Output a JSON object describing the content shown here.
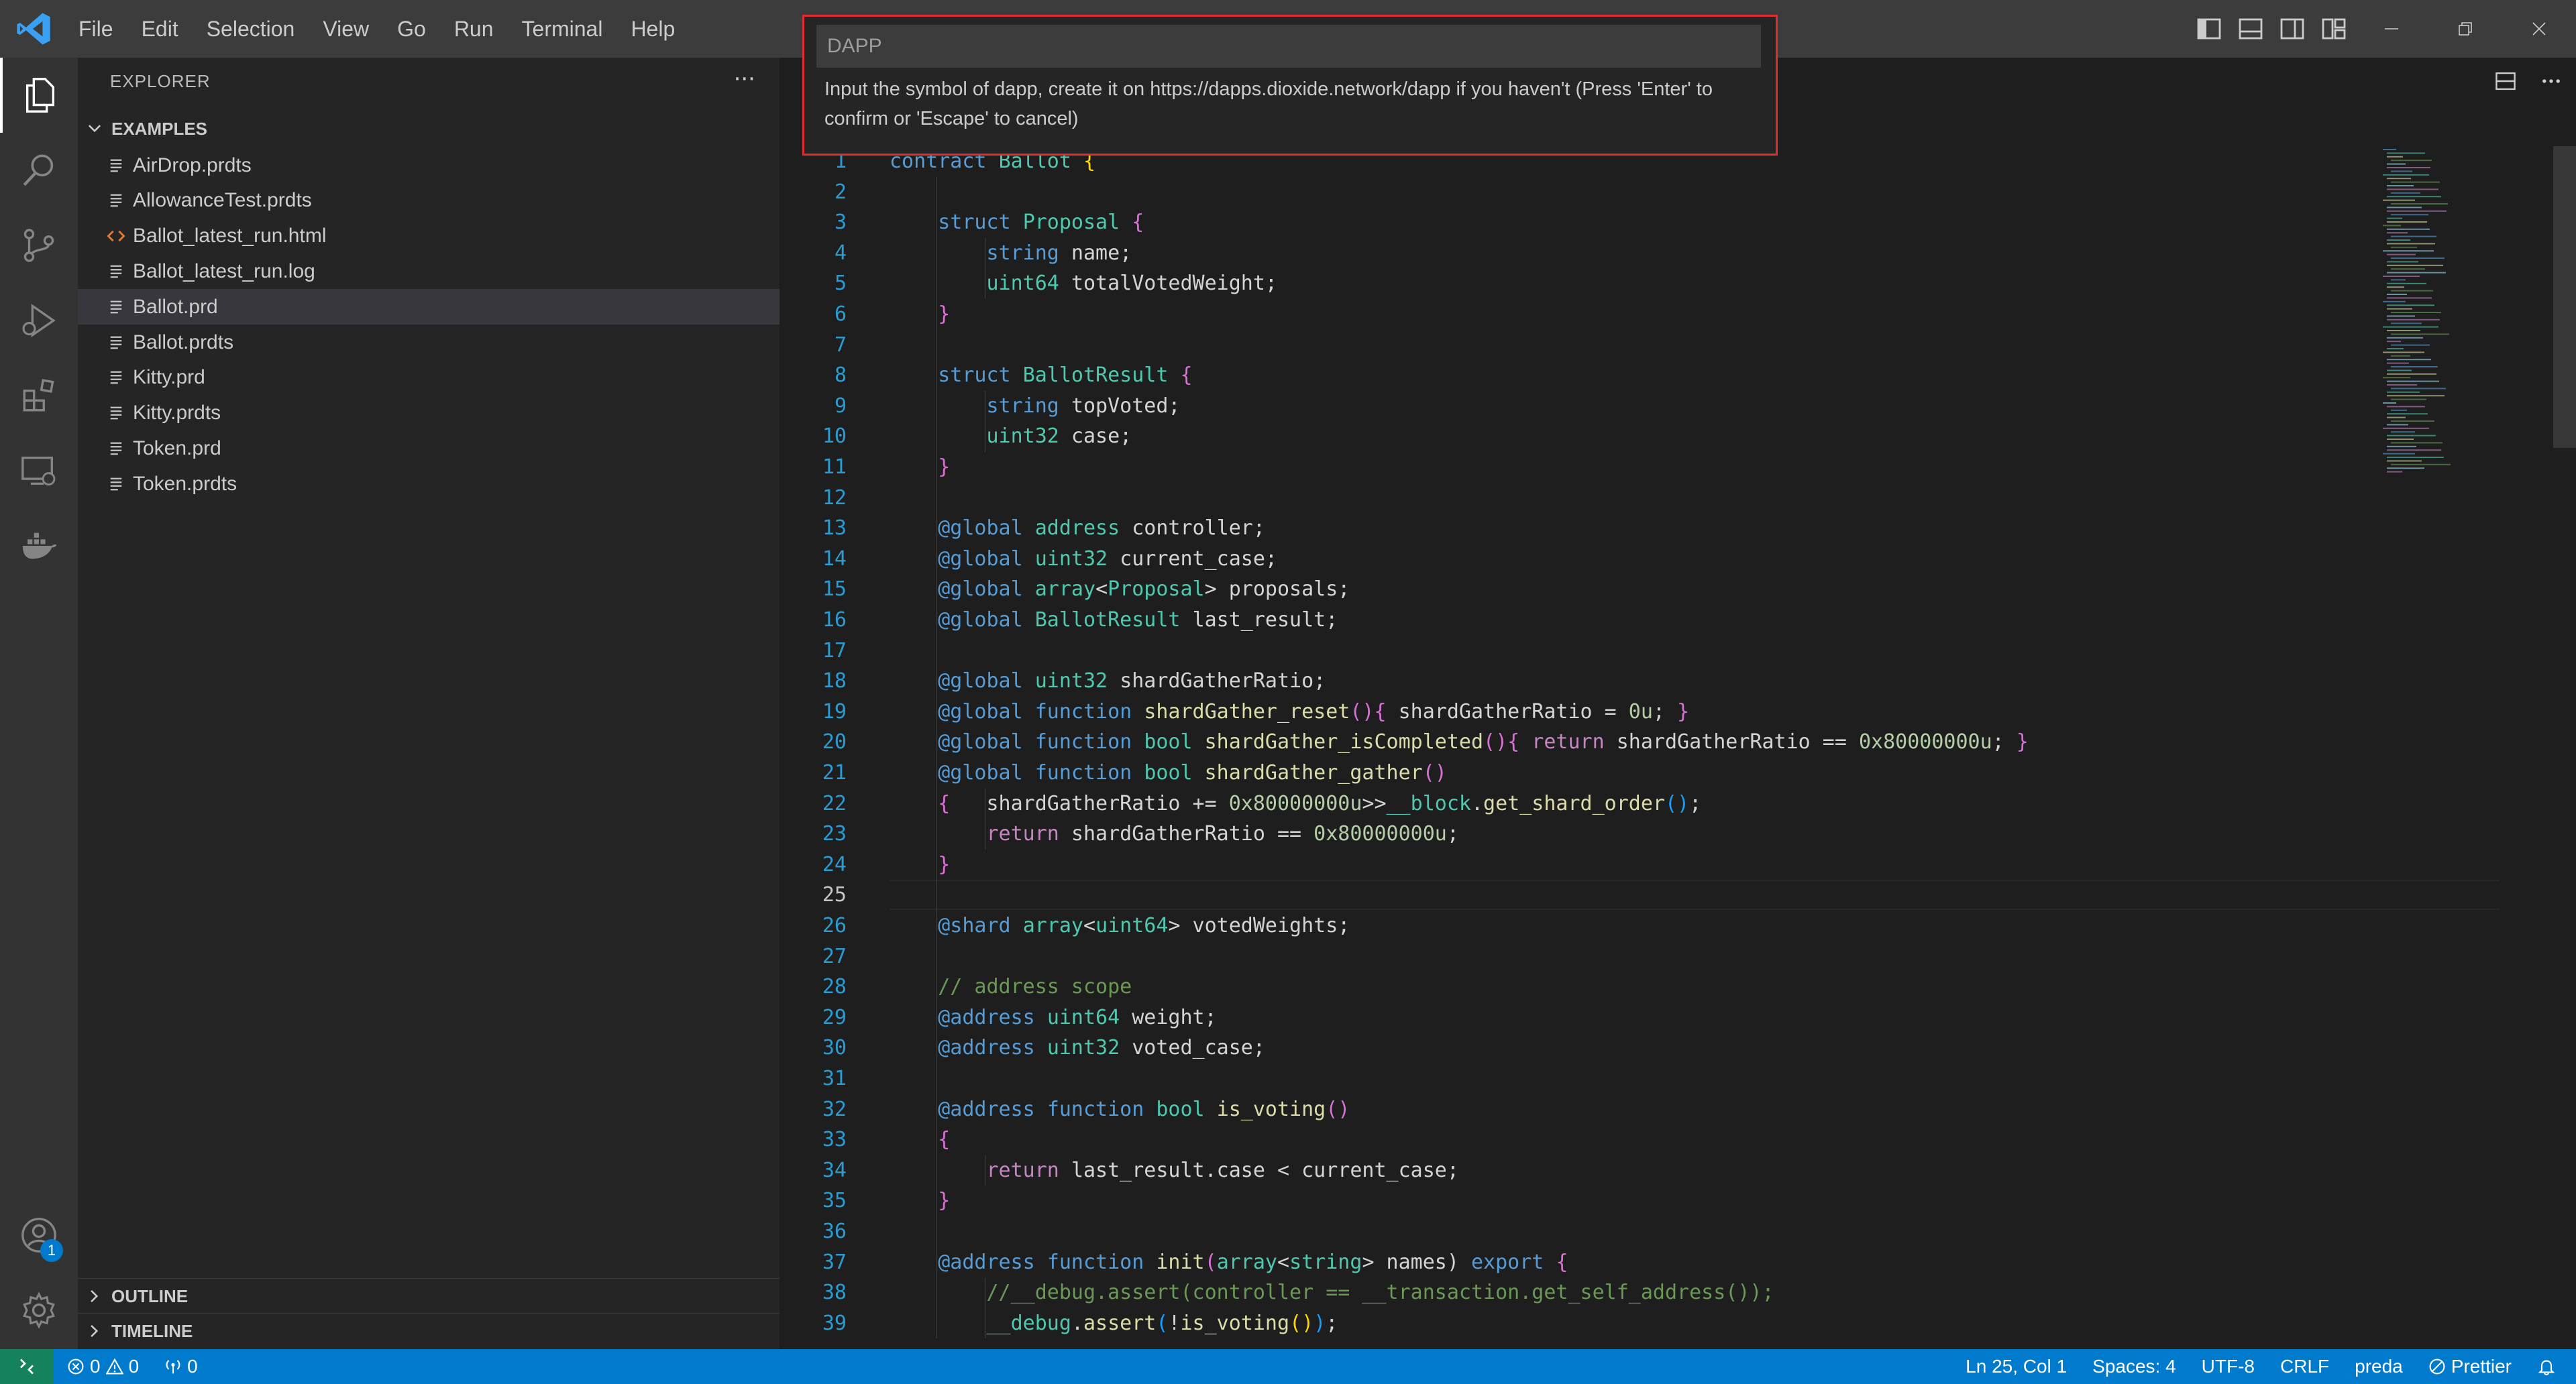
{
  "menu": [
    "File",
    "Edit",
    "Selection",
    "View",
    "Go",
    "Run",
    "Terminal",
    "Help"
  ],
  "colors": {
    "accent": "#007acc",
    "remote": "#16825d",
    "highlight_border": "#e02d2d"
  },
  "explorer": {
    "title": "EXPLORER",
    "more": "···",
    "folder": "EXAMPLES",
    "files": [
      {
        "name": "AirDrop.prdts",
        "icon": "file-lines-icon"
      },
      {
        "name": "AllowanceTest.prdts",
        "icon": "file-lines-icon"
      },
      {
        "name": "Ballot_latest_run.html",
        "icon": "html-code-icon"
      },
      {
        "name": "Ballot_latest_run.log",
        "icon": "file-lines-icon"
      },
      {
        "name": "Ballot.prd",
        "icon": "file-lines-icon",
        "selected": true
      },
      {
        "name": "Ballot.prdts",
        "icon": "file-lines-icon"
      },
      {
        "name": "Kitty.prd",
        "icon": "file-lines-icon"
      },
      {
        "name": "Kitty.prdts",
        "icon": "file-lines-icon"
      },
      {
        "name": "Token.prd",
        "icon": "file-lines-icon"
      },
      {
        "name": "Token.prdts",
        "icon": "file-lines-icon"
      }
    ],
    "outline": "OUTLINE",
    "timeline": "TIMELINE"
  },
  "quick_input": {
    "placeholder": "DAPP",
    "message": "Input the symbol of dapp, create it on https://dapps.dioxide.network/dapp if you haven't (Press 'Enter' to confirm or 'Escape' to cancel)"
  },
  "accounts_badge": "1",
  "code": {
    "current_line": 25,
    "lines": [
      [
        [
          "kw",
          "contract "
        ],
        [
          "ty",
          "Ballot "
        ],
        [
          "br1",
          "{"
        ]
      ],
      [],
      [
        [
          "id",
          "    "
        ],
        [
          "kw",
          "struct "
        ],
        [
          "ty",
          "Proposal "
        ],
        [
          "br2",
          "{"
        ]
      ],
      [
        [
          "id",
          "        "
        ],
        [
          "kw",
          "string "
        ],
        [
          "id",
          "name;"
        ]
      ],
      [
        [
          "id",
          "        "
        ],
        [
          "ty",
          "uint64 "
        ],
        [
          "id",
          "totalVotedWeight;"
        ]
      ],
      [
        [
          "id",
          "    "
        ],
        [
          "br2",
          "}"
        ]
      ],
      [],
      [
        [
          "id",
          "    "
        ],
        [
          "kw",
          "struct "
        ],
        [
          "ty",
          "BallotResult "
        ],
        [
          "br2",
          "{"
        ]
      ],
      [
        [
          "id",
          "        "
        ],
        [
          "kw",
          "string "
        ],
        [
          "id",
          "topVoted;"
        ]
      ],
      [
        [
          "id",
          "        "
        ],
        [
          "ty",
          "uint32 "
        ],
        [
          "id",
          "case;"
        ]
      ],
      [
        [
          "id",
          "    "
        ],
        [
          "br2",
          "}"
        ]
      ],
      [],
      [
        [
          "id",
          "    "
        ],
        [
          "at",
          "@global "
        ],
        [
          "ty",
          "address "
        ],
        [
          "id",
          "controller;"
        ]
      ],
      [
        [
          "id",
          "    "
        ],
        [
          "at",
          "@global "
        ],
        [
          "ty",
          "uint32 "
        ],
        [
          "id",
          "current_case;"
        ]
      ],
      [
        [
          "id",
          "    "
        ],
        [
          "at",
          "@global "
        ],
        [
          "ty",
          "array"
        ],
        [
          "id",
          "<"
        ],
        [
          "ty",
          "Proposal"
        ],
        [
          "id",
          "> proposals;"
        ]
      ],
      [
        [
          "id",
          "    "
        ],
        [
          "at",
          "@global "
        ],
        [
          "ty",
          "BallotResult "
        ],
        [
          "id",
          "last_result;"
        ]
      ],
      [],
      [
        [
          "id",
          "    "
        ],
        [
          "at",
          "@global "
        ],
        [
          "ty",
          "uint32 "
        ],
        [
          "id",
          "shardGatherRatio;"
        ]
      ],
      [
        [
          "id",
          "    "
        ],
        [
          "at",
          "@global "
        ],
        [
          "kw",
          "function "
        ],
        [
          "fn",
          "shardGather_reset"
        ],
        [
          "br2",
          "()"
        ],
        [
          "br2",
          "{ "
        ],
        [
          "id",
          "shardGatherRatio = "
        ],
        [
          "nu",
          "0u"
        ],
        [
          "id",
          "; "
        ],
        [
          "br2",
          "}"
        ]
      ],
      [
        [
          "id",
          "    "
        ],
        [
          "at",
          "@global "
        ],
        [
          "kw",
          "function "
        ],
        [
          "ty",
          "bool "
        ],
        [
          "fn",
          "shardGather_isCompleted"
        ],
        [
          "br2",
          "()"
        ],
        [
          "br2",
          "{ "
        ],
        [
          "pp",
          "return "
        ],
        [
          "id",
          "shardGatherRatio == "
        ],
        [
          "nu",
          "0x80000000u"
        ],
        [
          "id",
          "; "
        ],
        [
          "br2",
          "}"
        ]
      ],
      [
        [
          "id",
          "    "
        ],
        [
          "at",
          "@global "
        ],
        [
          "kw",
          "function "
        ],
        [
          "ty",
          "bool "
        ],
        [
          "fn",
          "shardGather_gather"
        ],
        [
          "br2",
          "()"
        ]
      ],
      [
        [
          "id",
          "    "
        ],
        [
          "br2",
          "{"
        ],
        [
          "id",
          "   shardGatherRatio += "
        ],
        [
          "nu",
          "0x80000000u"
        ],
        [
          "id",
          ">>"
        ],
        [
          "ty",
          "__block"
        ],
        [
          "id",
          "."
        ],
        [
          "fn",
          "get_shard_order"
        ],
        [
          "br3",
          "()"
        ],
        [
          "id",
          ";"
        ]
      ],
      [
        [
          "id",
          "        "
        ],
        [
          "pp",
          "return "
        ],
        [
          "id",
          "shardGatherRatio == "
        ],
        [
          "nu",
          "0x80000000u"
        ],
        [
          "id",
          ";"
        ]
      ],
      [
        [
          "id",
          "    "
        ],
        [
          "br2",
          "}"
        ]
      ],
      [],
      [
        [
          "id",
          "    "
        ],
        [
          "at",
          "@shard "
        ],
        [
          "ty",
          "array"
        ],
        [
          "id",
          "<"
        ],
        [
          "ty",
          "uint64"
        ],
        [
          "id",
          "> votedWeights;"
        ]
      ],
      [],
      [
        [
          "id",
          "    "
        ],
        [
          "cm",
          "// address scope"
        ]
      ],
      [
        [
          "id",
          "    "
        ],
        [
          "at",
          "@address "
        ],
        [
          "ty",
          "uint64 "
        ],
        [
          "id",
          "weight;"
        ]
      ],
      [
        [
          "id",
          "    "
        ],
        [
          "at",
          "@address "
        ],
        [
          "ty",
          "uint32 "
        ],
        [
          "id",
          "voted_case;"
        ]
      ],
      [],
      [
        [
          "id",
          "    "
        ],
        [
          "at",
          "@address "
        ],
        [
          "kw",
          "function "
        ],
        [
          "ty",
          "bool "
        ],
        [
          "fn",
          "is_voting"
        ],
        [
          "br2",
          "()"
        ]
      ],
      [
        [
          "id",
          "    "
        ],
        [
          "br2",
          "{"
        ]
      ],
      [
        [
          "id",
          "        "
        ],
        [
          "pp",
          "return "
        ],
        [
          "id",
          "last_result.case < current_case;"
        ]
      ],
      [
        [
          "id",
          "    "
        ],
        [
          "br2",
          "}"
        ]
      ],
      [],
      [
        [
          "id",
          "    "
        ],
        [
          "at",
          "@address "
        ],
        [
          "kw",
          "function "
        ],
        [
          "fn",
          "init"
        ],
        [
          "br2",
          "("
        ],
        [
          "ty",
          "array"
        ],
        [
          "id",
          "<"
        ],
        [
          "ty",
          "string"
        ],
        [
          "id",
          "> names) "
        ],
        [
          "kw",
          "export "
        ],
        [
          "br2",
          "{"
        ]
      ],
      [
        [
          "id",
          "        "
        ],
        [
          "cm",
          "//__debug.assert(controller == __transaction.get_self_address());"
        ]
      ],
      [
        [
          "id",
          "        "
        ],
        [
          "ty",
          "__debug"
        ],
        [
          "id",
          "."
        ],
        [
          "fn",
          "assert"
        ],
        [
          "br3",
          "("
        ],
        [
          "id",
          "!"
        ],
        [
          "fn",
          "is_voting"
        ],
        [
          "br1",
          "()"
        ],
        [
          "br3",
          ")"
        ],
        [
          "id",
          ";"
        ]
      ]
    ]
  },
  "status": {
    "errors": "0",
    "warnings": "0",
    "ports": "0",
    "position": "Ln 25, Col 1",
    "spaces": "Spaces: 4",
    "encoding": "UTF-8",
    "eol": "CRLF",
    "language": "preda",
    "formatter": "Prettier"
  }
}
